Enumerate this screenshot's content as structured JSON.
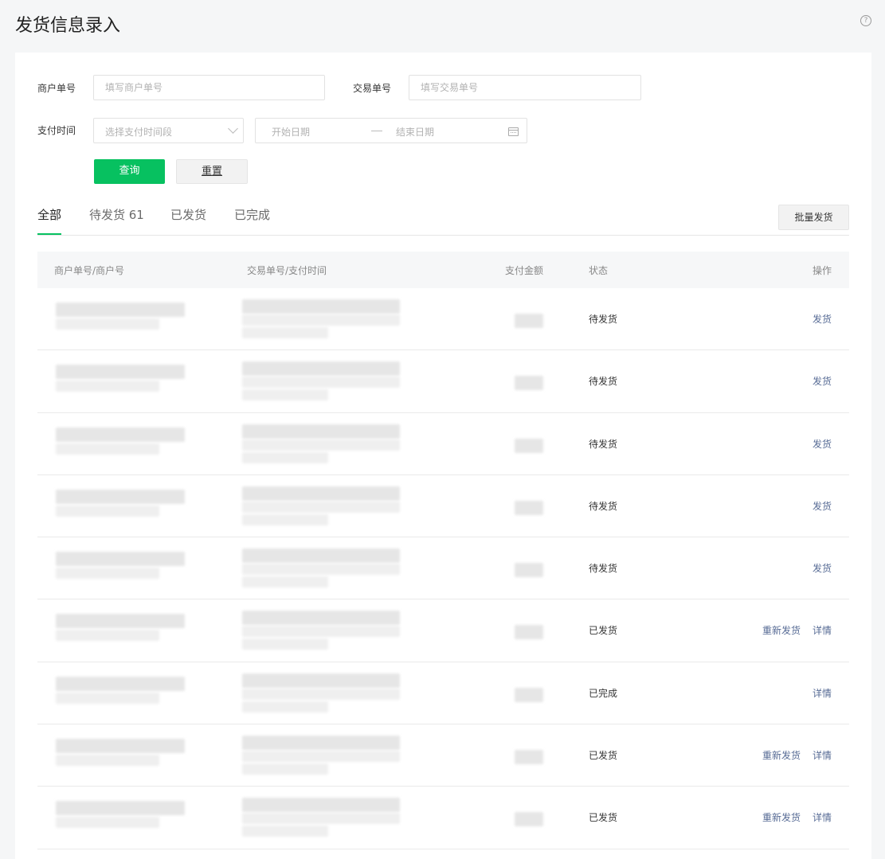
{
  "header": {
    "title": "发货信息录入",
    "help_icon": "?"
  },
  "filters": {
    "merchant_order_label": "商户单号",
    "merchant_order_placeholder": "填写商户单号",
    "trade_order_label": "交易单号",
    "trade_order_placeholder": "填写交易单号",
    "pay_time_label": "支付时间",
    "pay_time_select_placeholder": "选择支付时间段",
    "date_start_placeholder": "开始日期",
    "date_end_placeholder": "结束日期",
    "query_button": "查询",
    "reset_button": "重置"
  },
  "tabs": [
    {
      "label": "全部",
      "active": true
    },
    {
      "label": "待发货 61",
      "active": false
    },
    {
      "label": "已发货",
      "active": false
    },
    {
      "label": "已完成",
      "active": false
    }
  ],
  "batch_button": "批量发货",
  "table": {
    "columns": [
      "商户单号/商户号",
      "交易单号/支付时间",
      "支付金额",
      "状态",
      "操作"
    ],
    "rows": [
      {
        "status": "待发货",
        "actions": [
          "发货"
        ]
      },
      {
        "status": "待发货",
        "actions": [
          "发货"
        ]
      },
      {
        "status": "待发货",
        "actions": [
          "发货"
        ]
      },
      {
        "status": "待发货",
        "actions": [
          "发货"
        ]
      },
      {
        "status": "待发货",
        "actions": [
          "发货"
        ]
      },
      {
        "status": "已发货",
        "actions": [
          "重新发货",
          "详情"
        ]
      },
      {
        "status": "已完成",
        "actions": [
          "详情"
        ]
      },
      {
        "status": "已发货",
        "actions": [
          "重新发货",
          "详情"
        ]
      },
      {
        "status": "已发货",
        "actions": [
          "重新发货",
          "详情"
        ]
      }
    ]
  },
  "colors": {
    "primary": "#07c160",
    "link": "#576b95"
  }
}
